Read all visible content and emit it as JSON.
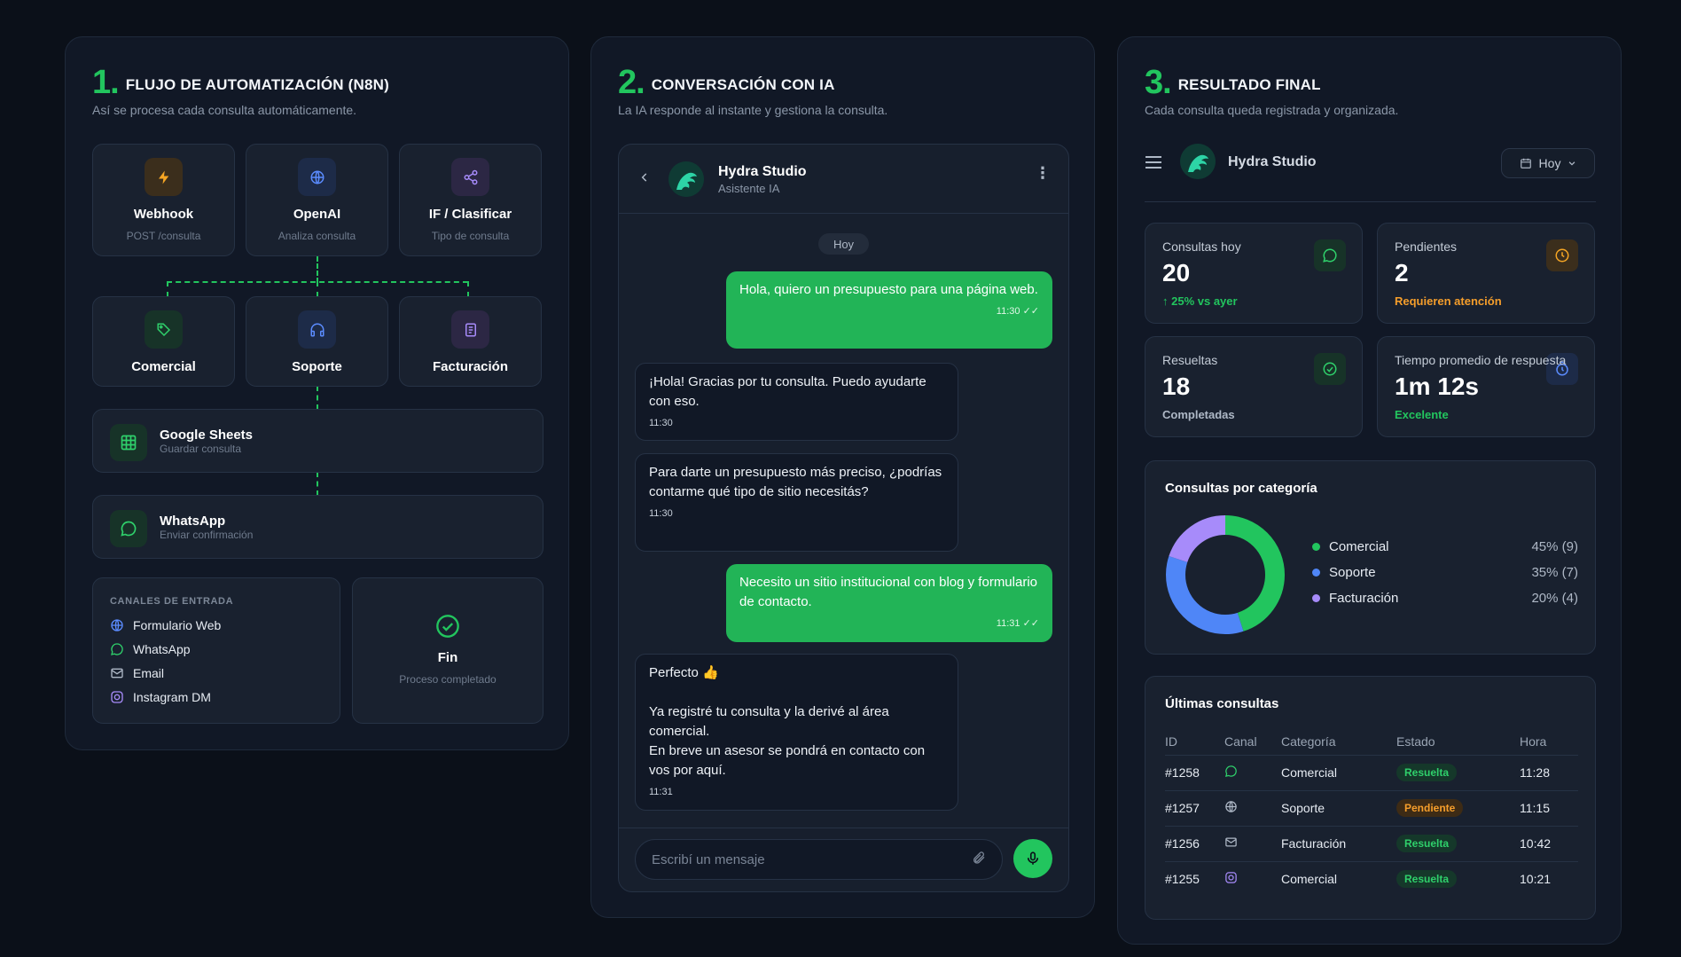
{
  "panel1": {
    "num": "1.",
    "title": "FLUJO DE AUTOMATIZACIÓN (N8N)",
    "subtitle": "Así se procesa cada consulta automáticamente.",
    "nodes": [
      {
        "title": "Webhook",
        "sub": "POST /consulta",
        "icon": "lightning-icon"
      },
      {
        "title": "OpenAI",
        "sub": "Analiza consulta",
        "icon": "globe-icon"
      },
      {
        "title": "IF / Clasificar",
        "sub": "Tipo de consulta",
        "icon": "share-icon"
      }
    ],
    "categories": [
      {
        "title": "Comercial",
        "icon": "tag-icon"
      },
      {
        "title": "Soporte",
        "icon": "headphones-icon"
      },
      {
        "title": "Facturación",
        "icon": "document-icon"
      }
    ],
    "sheets": {
      "title": "Google Sheets",
      "sub": "Guardar consulta"
    },
    "whatsapp": {
      "title": "WhatsApp",
      "sub": "Enviar confirmación"
    },
    "channels": {
      "title": "CANALES DE ENTRADA",
      "items": [
        "Formulario Web",
        "WhatsApp",
        "Email",
        "Instagram DM"
      ]
    },
    "end": {
      "title": "Fin",
      "sub": "Proceso completado"
    }
  },
  "panel2": {
    "num": "2.",
    "title": "CONVERSACIÓN CON IA",
    "subtitle": "La IA responde al instante y gestiona la consulta.",
    "chat": {
      "name": "Hydra Studio",
      "status": "Asistente IA",
      "date": "Hoy",
      "messages": [
        {
          "text": "Hola, quiero un presupuesto para una página web.",
          "time": "11:30 ✓✓"
        },
        {
          "text": "¡Hola! Gracias por tu consulta. Puedo ayudarte con eso.",
          "time": "11:30"
        },
        {
          "text": "Para darte un presupuesto más preciso, ¿podrías contarme qué tipo de sitio necesitás?",
          "time": "11:30"
        },
        {
          "text": "Necesito un sitio institucional con blog y formulario de contacto.",
          "time": "11:31 ✓✓"
        },
        {
          "line1": "Perfecto 👍",
          "line2": "Ya registré tu consulta y la derivé al área comercial.",
          "line3": "En breve un asesor se pondrá en contacto con vos por aquí.",
          "time": "11:31"
        }
      ],
      "placeholder": "Escribí un mensaje"
    }
  },
  "panel3": {
    "num": "3.",
    "title": "RESULTADO FINAL",
    "subtitle": "Cada consulta queda registrada y organizada.",
    "brand": "Hydra Studio",
    "filter": "Hoy",
    "stats": [
      {
        "label": "Consultas hoy",
        "value": "20",
        "note": "↑ 25% vs ayer",
        "color": "#22c55e"
      },
      {
        "label": "Pendientes",
        "value": "2",
        "note": "Requieren atención",
        "color": "#f59e2b"
      },
      {
        "label": "Resueltas",
        "value": "18",
        "note": "Completadas",
        "color": "#aeb8c6"
      },
      {
        "label": "Tiempo promedio de respuesta",
        "value": "1m 12s",
        "note": "Excelente",
        "color": "#22c55e"
      }
    ],
    "chart_title": "Consultas por categoría",
    "chart_data": {
      "type": "pie",
      "categories": [
        "Comercial",
        "Soporte",
        "Facturación"
      ],
      "values": [
        45,
        35,
        20
      ],
      "counts": [
        9,
        7,
        4
      ],
      "labels": [
        "45% (9)",
        "35% (7)",
        "20% (4)"
      ],
      "colors": [
        "#22c55e",
        "#4f86f7",
        "#a78bfa"
      ]
    },
    "table": {
      "title": "Últimas consultas",
      "headers": [
        "ID",
        "Canal",
        "Categoría",
        "Estado",
        "Hora"
      ],
      "rows": [
        {
          "id": "#1258",
          "channel": "whatsapp-icon",
          "category": "Comercial",
          "status": "Resuelta",
          "time": "11:28"
        },
        {
          "id": "#1257",
          "channel": "globe-icon",
          "category": "Soporte",
          "status": "Pendiente",
          "time": "11:15"
        },
        {
          "id": "#1256",
          "channel": "mail-icon",
          "category": "Facturación",
          "status": "Resuelta",
          "time": "10:42"
        },
        {
          "id": "#1255",
          "channel": "instagram-icon",
          "category": "Comercial",
          "status": "Resuelta",
          "time": "10:21"
        }
      ]
    }
  }
}
